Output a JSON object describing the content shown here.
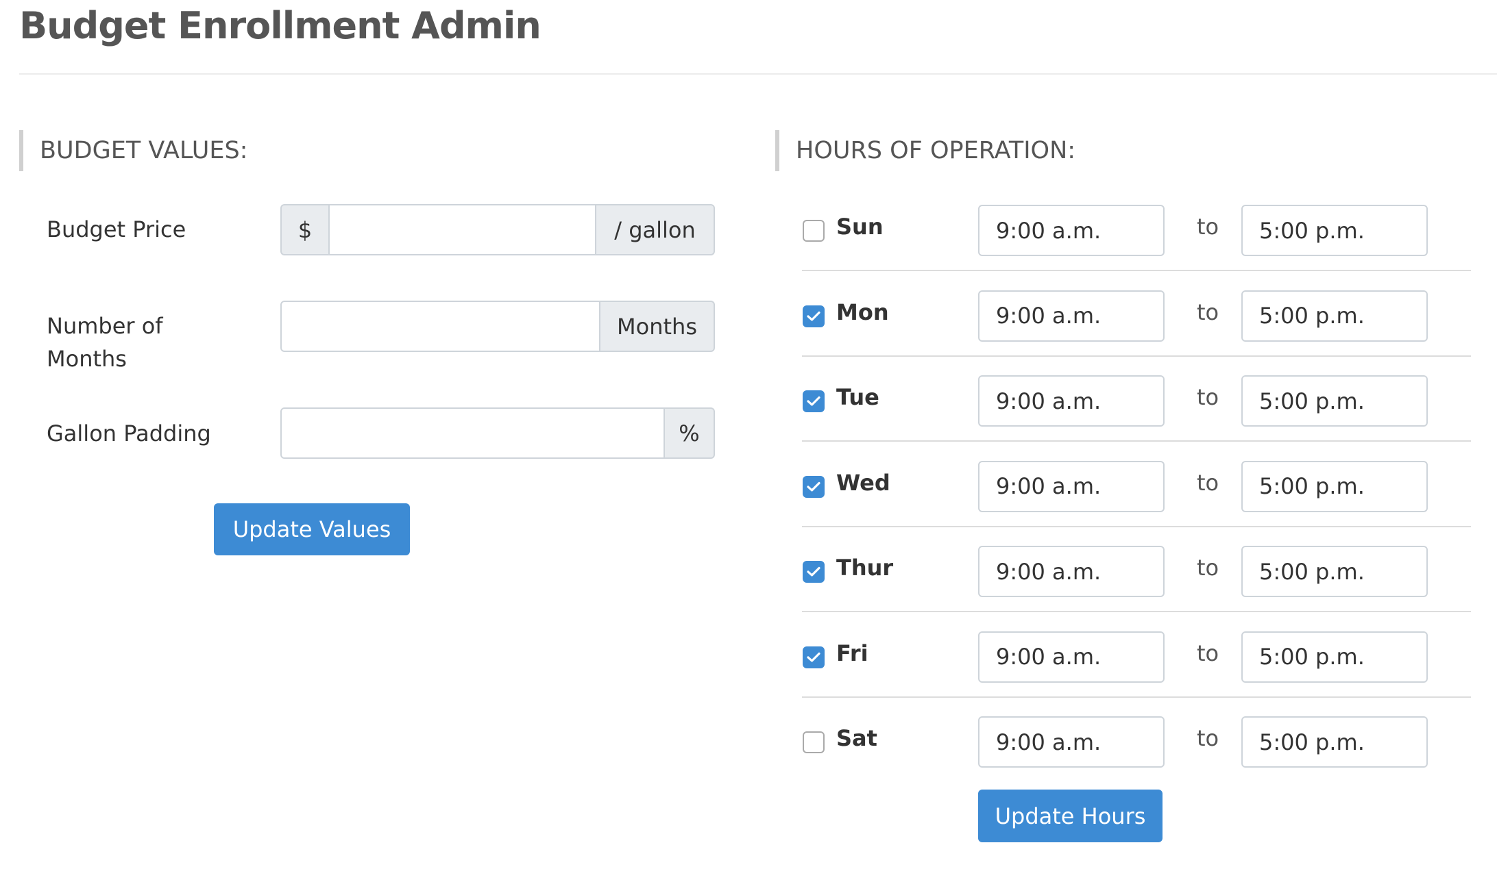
{
  "header": {
    "title": "Budget Enrollment Admin"
  },
  "budget": {
    "heading": "BUDGET VALUES:",
    "price": {
      "label": "Budget Price",
      "prefix": "$",
      "suffix": "/ gallon",
      "value": ""
    },
    "months": {
      "label_line1": "Number of",
      "label_line2": "Months",
      "suffix": "Months",
      "value": ""
    },
    "padding": {
      "label": "Gallon Padding",
      "suffix": "%",
      "value": ""
    },
    "update_label": "Update Values"
  },
  "hours": {
    "heading": "HOURS OF OPERATION:",
    "to_label": "to",
    "days": [
      {
        "day": "Sun",
        "checked": false,
        "open": "9:00 a.m.",
        "close": "5:00 p.m."
      },
      {
        "day": "Mon",
        "checked": true,
        "open": "9:00 a.m.",
        "close": "5:00 p.m."
      },
      {
        "day": "Tue",
        "checked": true,
        "open": "9:00 a.m.",
        "close": "5:00 p.m."
      },
      {
        "day": "Wed",
        "checked": true,
        "open": "9:00 a.m.",
        "close": "5:00 p.m."
      },
      {
        "day": "Thur",
        "checked": true,
        "open": "9:00 a.m.",
        "close": "5:00 p.m."
      },
      {
        "day": "Fri",
        "checked": true,
        "open": "9:00 a.m.",
        "close": "5:00 p.m."
      },
      {
        "day": "Sat",
        "checked": false,
        "open": "9:00 a.m.",
        "close": "5:00 p.m."
      }
    ],
    "update_label": "Update Hours"
  },
  "colors": {
    "accent": "#3d8bd4",
    "addon_bg": "#e9ecef",
    "border": "#ced4da",
    "title": "#555555"
  }
}
